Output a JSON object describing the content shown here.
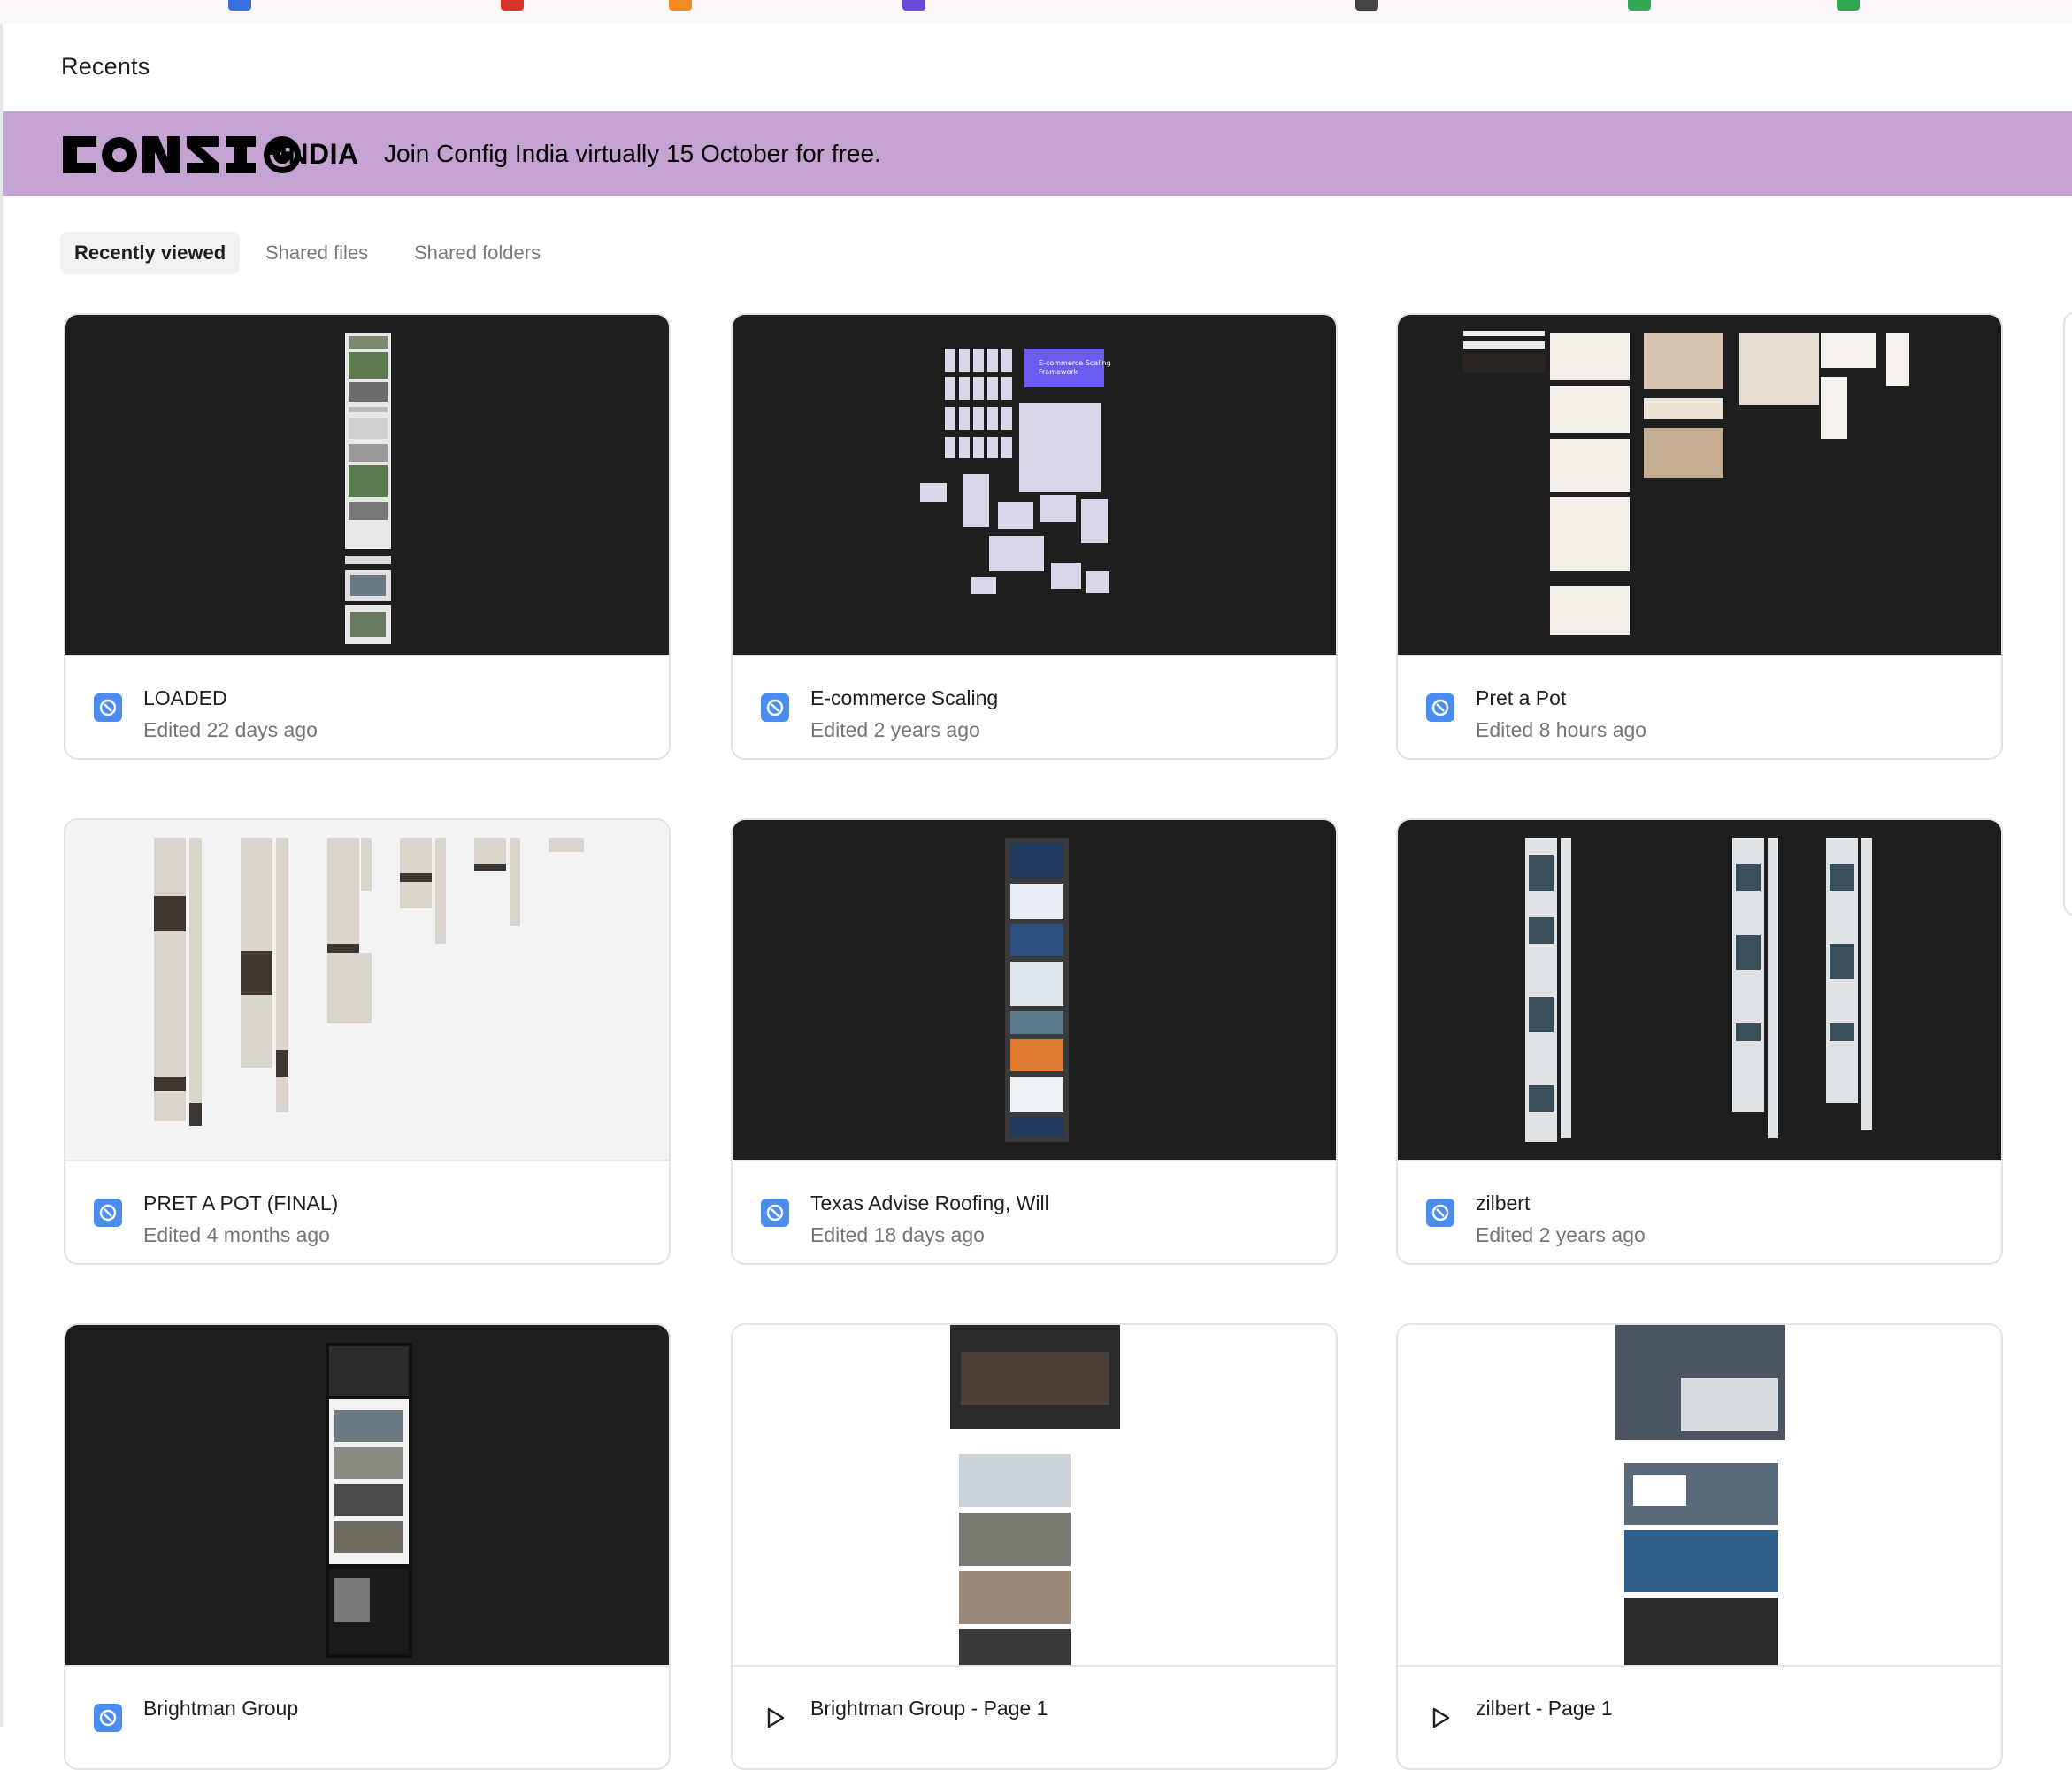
{
  "page": {
    "title": "Recents"
  },
  "banner": {
    "logo_text": "CONFIG",
    "logo_suffix": "INDIA",
    "message": "Join Config India virtually 15 October for free."
  },
  "tabs": [
    {
      "label": "Recently viewed",
      "active": true
    },
    {
      "label": "Shared files",
      "active": false
    },
    {
      "label": "Shared folders",
      "active": false
    }
  ],
  "files": [
    {
      "name": "LOADED",
      "edited": "Edited 22 days ago",
      "kind": "design",
      "thumb_bg": "dark"
    },
    {
      "name": "E-commerce Scaling",
      "edited": "Edited 2 years ago",
      "kind": "design",
      "thumb_bg": "dark"
    },
    {
      "name": "Pret a Pot",
      "edited": "Edited 8 hours ago",
      "kind": "design",
      "thumb_bg": "dark"
    },
    {
      "name": "PRET A POT (FINAL)",
      "edited": "Edited 4 months ago",
      "kind": "design",
      "thumb_bg": "light"
    },
    {
      "name": "Texas Advise Roofing, Will",
      "edited": "Edited 18 days ago",
      "kind": "design",
      "thumb_bg": "dark"
    },
    {
      "name": "zilbert",
      "edited": "Edited 2 years ago",
      "kind": "design",
      "thumb_bg": "dark"
    },
    {
      "name": "Brightman Group",
      "edited": "",
      "kind": "design",
      "thumb_bg": "dark"
    },
    {
      "name": "Brightman Group - Page 1",
      "edited": "",
      "kind": "prototype",
      "thumb_bg": "white"
    },
    {
      "name": "zilbert - Page 1",
      "edited": "",
      "kind": "prototype",
      "thumb_bg": "white"
    }
  ],
  "colors": {
    "banner_bg": "#c4a2d2",
    "design_icon": "#4a8cf0",
    "thumb_dark": "#1e1e1e"
  },
  "icons": {
    "design": "figma-design-file-icon",
    "prototype": "play-icon"
  }
}
